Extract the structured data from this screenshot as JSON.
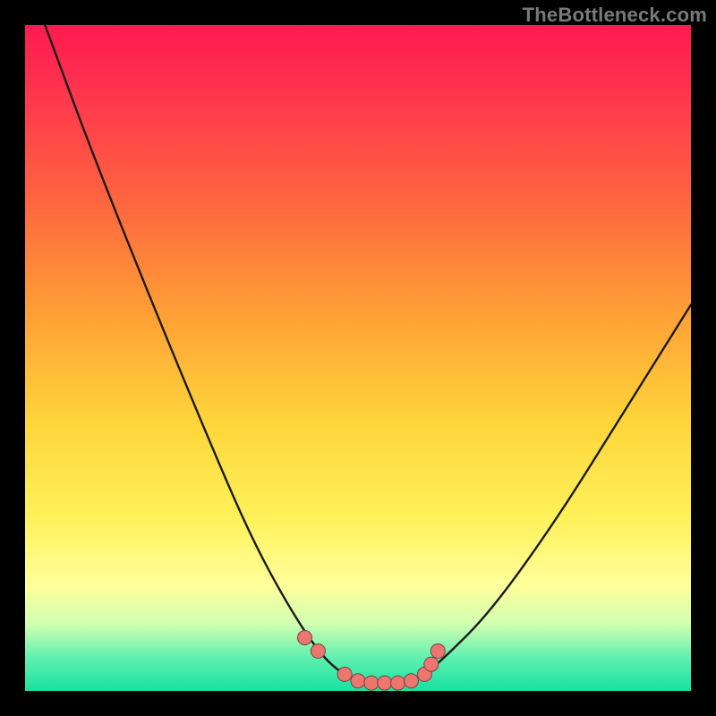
{
  "watermark": {
    "text": "TheBottleneck.com"
  },
  "colors": {
    "frame": "#000000",
    "curve_stroke": "#1a1a1a",
    "marker_fill": "#ed766e",
    "marker_stroke": "#784040",
    "gradient_stops": [
      "#ff1a50",
      "#ff3a4c",
      "#ff6a3e",
      "#ffa236",
      "#ffd63a",
      "#fff15a",
      "#ffff9a",
      "#d0ffb0",
      "#60f0b0",
      "#18e0a0"
    ]
  },
  "chart_data": {
    "type": "line",
    "title": "",
    "xlabel": "",
    "ylabel": "",
    "xlim": [
      0,
      100
    ],
    "ylim": [
      0,
      100
    ],
    "series": [
      {
        "name": "bottleneck-curve",
        "x": [
          3,
          10,
          20,
          30,
          35,
          40,
          44,
          47,
          50,
          52,
          54,
          56,
          58,
          60,
          63,
          70,
          80,
          90,
          100
        ],
        "y": [
          100,
          81,
          56,
          32,
          21,
          12,
          6,
          3,
          1.5,
          1,
          1,
          1,
          1.5,
          2.5,
          5,
          12,
          26,
          42,
          58
        ]
      }
    ],
    "markers": {
      "name": "highlight-points",
      "x": [
        42,
        44,
        48,
        50,
        52,
        54,
        56,
        58,
        60,
        61,
        62
      ],
      "y": [
        8,
        6,
        2.5,
        1.5,
        1.2,
        1.2,
        1.2,
        1.5,
        2.5,
        4,
        6
      ]
    },
    "grid": false,
    "legend": false
  }
}
